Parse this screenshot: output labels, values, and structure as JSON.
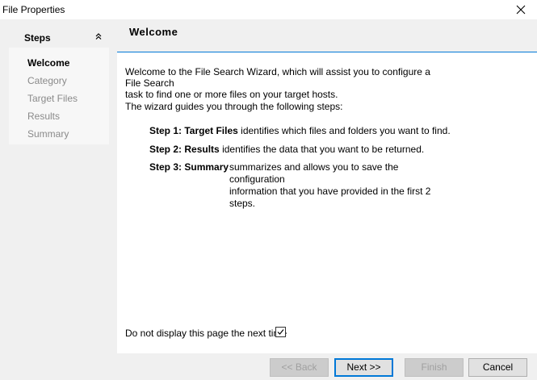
{
  "window": {
    "title": "File Properties",
    "close_icon": "close-icon"
  },
  "sidebar": {
    "header": "Steps",
    "collapse_icon": "double-chevron-up-icon",
    "items": [
      {
        "label": "Welcome",
        "active": true
      },
      {
        "label": "Category",
        "active": false
      },
      {
        "label": "Target Files",
        "active": false
      },
      {
        "label": "Results",
        "active": false
      },
      {
        "label": "Summary",
        "active": false
      }
    ]
  },
  "main": {
    "title": "Welcome",
    "intro": "Welcome to the File Search Wizard, which will assist you to configure a File Search\ntask to find one or more files on your target hosts.",
    "guide": "The wizard guides you through the following steps:",
    "steps": [
      {
        "label": "Step 1:",
        "name": "Target Files",
        "desc": "identifies which files and folders you want to find."
      },
      {
        "label": "Step 2:",
        "name": "Results",
        "desc": "identifies the data that you want to be returned."
      },
      {
        "label": "Step 3:",
        "name": "Summary",
        "desc": "summarizes and allows you to save the configuration\ninformation that you have provided in the first 2 steps."
      }
    ],
    "dont_display_label": "Do not display this page the next time",
    "dont_display_checked": true
  },
  "footer": {
    "back_label": "<< Back",
    "next_label": "Next >>",
    "finish_label": "Finish",
    "cancel_label": "Cancel"
  },
  "colors": {
    "accent": "#0078d7",
    "disabled_text": "#a0a0a0",
    "inactive_step": "#8a8a8a"
  }
}
